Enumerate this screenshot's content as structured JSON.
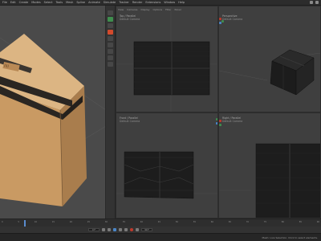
{
  "menubar": {
    "items": [
      "File",
      "Edit",
      "Create",
      "Modes",
      "Select",
      "Tools",
      "Mesh",
      "Spline",
      "Animate",
      "Simulate",
      "Tracker",
      "Render",
      "Extensions",
      "Window",
      "Help"
    ]
  },
  "viewports": {
    "top": {
      "title": "Top / Parallel",
      "subtitle": "Default Camera"
    },
    "right_top": {
      "title": "Perspective",
      "subtitle": "Default Camera"
    },
    "bottom_left": {
      "title": "Front / Parallel",
      "subtitle": "Default Camera"
    },
    "bottom_right": {
      "title": "Right / Parallel",
      "subtitle": "Default Camera"
    },
    "header_items": [
      "View",
      "Cameras",
      "Display",
      "Options",
      "Filter",
      "Panel"
    ]
  },
  "timeline": {
    "ticks": [
      "0",
      "5",
      "10",
      "15",
      "20",
      "25",
      "30",
      "35",
      "40",
      "45",
      "50",
      "55",
      "60",
      "65",
      "70",
      "75",
      "80",
      "85",
      "90"
    ]
  },
  "playbar": {
    "current_frame": "0 F",
    "end_frame": "90 F"
  },
  "status": {
    "message": "Mesh: Live Selection. Click to select elements."
  },
  "colors": {
    "accent_red": "#d34a2c",
    "axis_green": "#3f8e4e",
    "axis_blue": "#4a86c8",
    "box_tan": "#c99a63"
  }
}
